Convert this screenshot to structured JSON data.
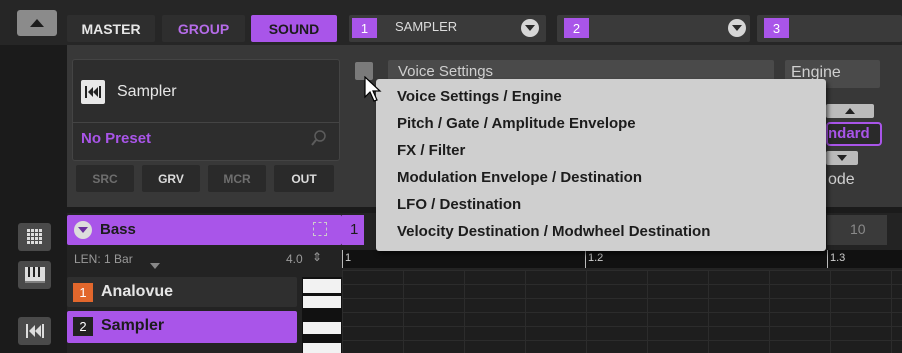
{
  "topbar": {
    "master": "MASTER",
    "group": "GROUP",
    "sound": "SOUND",
    "slots": [
      {
        "num": "1",
        "label": "SAMPLER"
      },
      {
        "num": "2",
        "label": ""
      },
      {
        "num": "3",
        "label": ""
      }
    ]
  },
  "plugin": {
    "name": "Sampler",
    "preset": "No Preset",
    "buttons": [
      "SRC",
      "GRV",
      "MCR",
      "OUT"
    ]
  },
  "page_select": {
    "current": "Voice Settings",
    "engine_label": "Engine",
    "standard_value": "ndard",
    "mode_label": "ode"
  },
  "page_menu": {
    "items": [
      "Voice Settings / Engine",
      "Pitch / Gate / Amplitude Envelope",
      "FX / Filter",
      "Modulation Envelope / Destination",
      "LFO / Destination",
      "Velocity Destination / Modwheel Destination"
    ]
  },
  "pattern": {
    "group_name": "Bass",
    "length_label": "LEN: 1 Bar",
    "length_value": "4.0",
    "pattern_tabs": [
      "1",
      "10"
    ],
    "ruler": [
      "1",
      "1.2",
      "1.3"
    ]
  },
  "sounds": [
    {
      "num": "1",
      "name": "Analovue",
      "color": "#e2672c"
    },
    {
      "num": "2",
      "name": "Sampler",
      "color": "#a955e9"
    }
  ],
  "colors": {
    "accent_purple": "#a955e9",
    "group_text": "#b56ce8",
    "orange": "#e2672c"
  }
}
